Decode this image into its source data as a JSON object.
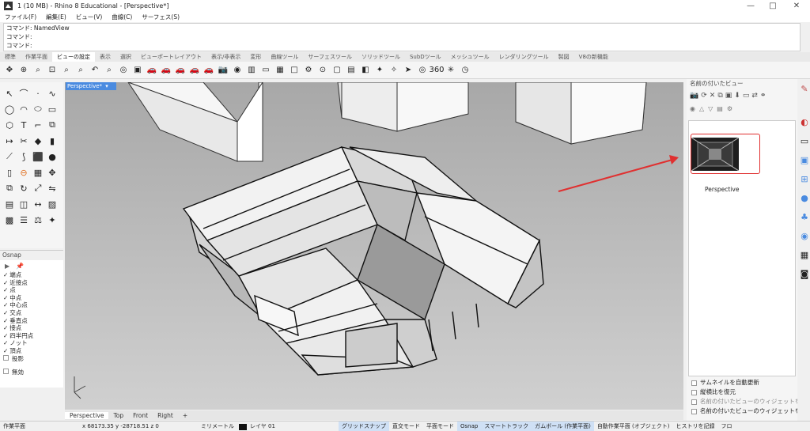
{
  "window": {
    "title": "1 (10 MB) - Rhino 8 Educational - [Perspective*]",
    "minimize": "—",
    "maximize": "□",
    "close": "✕"
  },
  "menubar": [
    "ファイル(F)",
    "編集(E)",
    "ビュー(V)",
    "曲線(C)",
    "サーフェス(S)"
  ],
  "command_history": [
    "コマンド: NamedView",
    "コマンド:",
    "コマンド:"
  ],
  "toolbar_tabs": {
    "items": [
      "標準",
      "作業平面",
      "ビューの設定",
      "表示",
      "選択",
      "ビューポートレイアウト",
      "表示/非表示",
      "変形",
      "曲線ツール",
      "サーフェスツール",
      "ソリッドツール",
      "SubDツール",
      "メッシュツール",
      "レンダリングツール",
      "製図",
      "V8の新機能"
    ],
    "active": "ビューの設定"
  },
  "toolbar_icons": [
    "pan-icon",
    "rotate-icon",
    "zoom-icon",
    "zoom-window-icon",
    "zoom-extents-icon",
    "zoom-selected-icon",
    "undo-view-icon",
    "zoom-dynamic-icon",
    "target-icon",
    "named-views-icon",
    "car-red-1-icon",
    "car-red-2-icon",
    "car-red-3-icon",
    "car-red-4-icon",
    "car-red-5-icon",
    "camera-icon",
    "camera-lens-icon",
    "wall-icon",
    "flat-surface-icon",
    "grid-icon",
    "square-icon",
    "gear-icon",
    "orbit-icon",
    "frame-icon",
    "image-icon",
    "cube-icon",
    "light-icon",
    "spotlight-icon",
    "arrow-icon",
    "lens-icon",
    "view-360-icon",
    "spark-icon",
    "clock-icon"
  ],
  "viewport": {
    "active_label": "Perspective*",
    "tabs": [
      "Perspective",
      "Top",
      "Front",
      "Right"
    ],
    "add_tab": "+"
  },
  "osnap": {
    "title": "Osnap",
    "items": [
      {
        "label": "端点",
        "checked": true
      },
      {
        "label": "近接点",
        "checked": true
      },
      {
        "label": "点",
        "checked": true
      },
      {
        "label": "中点",
        "checked": true
      },
      {
        "label": "中心点",
        "checked": true
      },
      {
        "label": "交点",
        "checked": true
      },
      {
        "label": "垂直点",
        "checked": true
      },
      {
        "label": "接点",
        "checked": true
      },
      {
        "label": "四半円点",
        "checked": true
      },
      {
        "label": "ノット",
        "checked": true
      },
      {
        "label": "頂点",
        "checked": true
      },
      {
        "label": "投影",
        "checked": false
      }
    ],
    "disable_label": "無効"
  },
  "named_views_panel": {
    "title": "名前の付いたビュー",
    "view_name": "Perspective",
    "options": [
      {
        "label": "サムネイルを自動更新",
        "enabled": true
      },
      {
        "label": "縦横比を復元",
        "enabled": true
      },
      {
        "label": "名前の付いたビューのウィジェットを",
        "enabled": false
      },
      {
        "label": "名前の付いたビューのウィジェットを",
        "enabled": true
      }
    ]
  },
  "statusbar": {
    "cplane": "作業平面",
    "coords": "x 68173.35  y -28718.51  z 0",
    "units": "ミリメートル",
    "layer": "レイヤ 01",
    "grid_snap": "グリッドスナップ",
    "ortho": "直交モード",
    "planar": "平面モード",
    "osnap": "Osnap",
    "smarttrack": "スマートトラック",
    "gumball": "ガムボール (作業平面)",
    "auto_cplane": "自動作業平面 (オブジェクト)",
    "history": "ヒストリを記録",
    "filter": "フロ"
  },
  "colors": {
    "accent": "#4a8be0",
    "highlight": "#e03030",
    "viewport_bg": "#bcbcbc"
  }
}
